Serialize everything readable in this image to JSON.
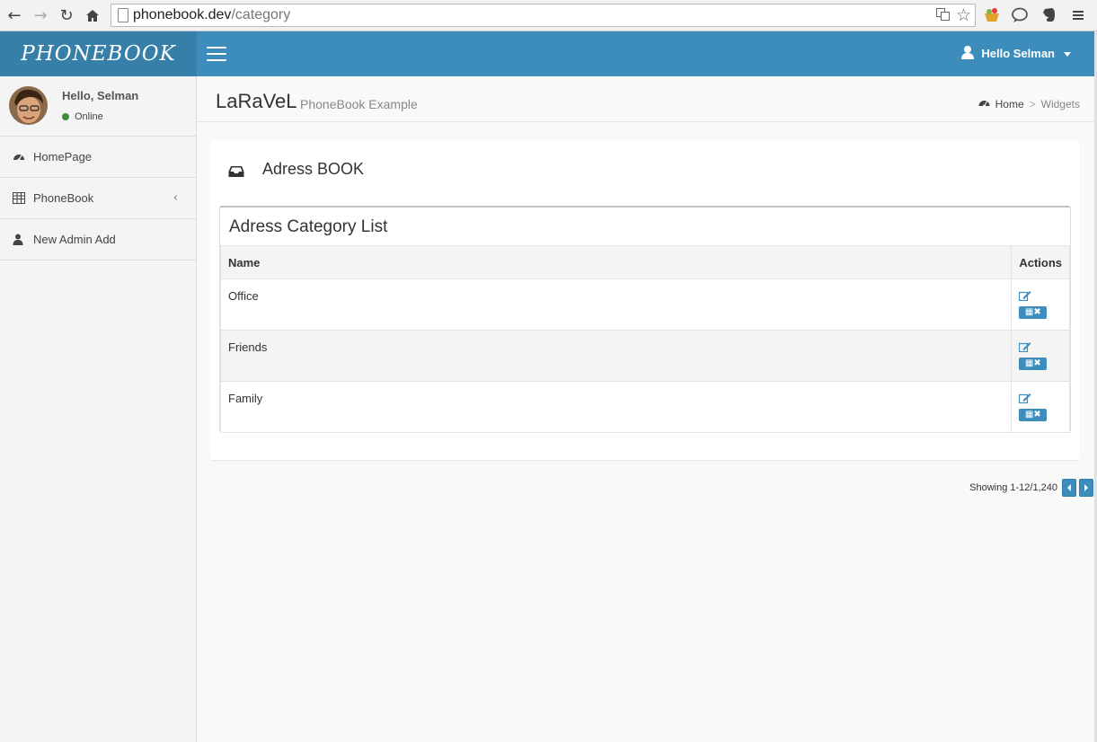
{
  "browser": {
    "url_host": "phonebook.dev",
    "url_path": "/category",
    "back_icon": "arrow-left-icon",
    "forward_icon": "arrow-right-icon",
    "reload_icon": "reload-icon",
    "home_icon": "home-icon"
  },
  "app": {
    "logo": "PHONEBOOK",
    "user_menu_label": "Hello Selman",
    "accent": "#3c8dbc",
    "accent_dark": "#367fa9"
  },
  "sidebar": {
    "greeting": "Hello, Selman",
    "status": "Online",
    "status_color": "#3d8b3d",
    "items": [
      {
        "label": "HomePage",
        "icon": "dashboard-icon"
      },
      {
        "label": "PhoneBook",
        "icon": "table-icon"
      },
      {
        "label": "New Admin Add",
        "icon": "user-icon"
      }
    ]
  },
  "header": {
    "title": "LaRaVeL",
    "subtitle": "PhoneBook Example",
    "breadcrumb": {
      "home": "Home",
      "separator": ">",
      "current": "Widgets"
    }
  },
  "box": {
    "title": "Adress BOOK",
    "panel_title": "Adress Category List",
    "columns": [
      "Name",
      "Actions"
    ],
    "rows": [
      {
        "name": "Office"
      },
      {
        "name": "Friends"
      },
      {
        "name": "Family"
      }
    ]
  },
  "pagination": {
    "text": "Showing 1-12/1,240"
  }
}
